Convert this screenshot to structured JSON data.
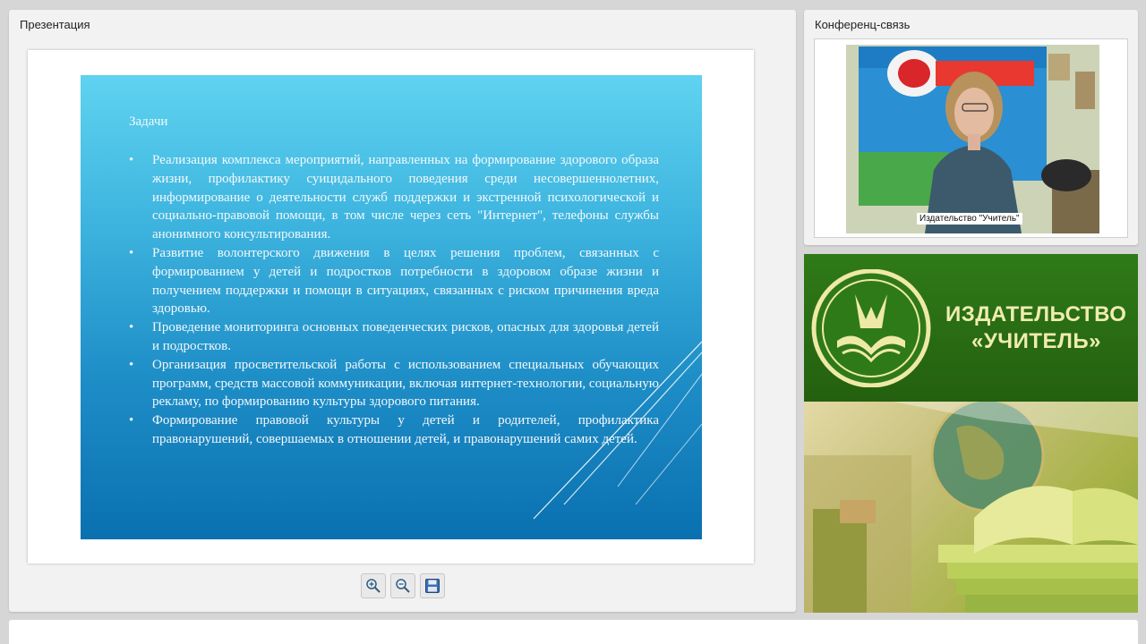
{
  "presentation": {
    "title": "Презентация",
    "slide": {
      "heading": "Задачи",
      "items": [
        "Реализация комплекса мероприятий, направленных на формирование здорового образа жизни, профилактику суицидального поведения среди несовершеннолетних, информирование о деятельности служб поддержки и экстренной психологической и социально-правовой помощи, в том числе через сеть \"Интернет\", телефоны службы анонимного консультирования.",
        "Развитие волонтерского движения в целях решения проблем, связанных с формированием у детей и подростков потребности в здоровом образе жизни и получением поддержки и помощи в ситуациях, связанных с риском причинения вреда здоровью.",
        "Проведение мониторинга основных поведенческих рисков, опасных для здоровья детей и подростков.",
        "Организация просветительской работы с использованием специальных обучающих программ, средств массовой коммуникации, включая интернет-технологии, социальную рекламу, по формированию культуры здорового питания.",
        "Формирование правовой культуры у детей и родителей, профилактика правонарушений, совершаемых в отношении детей, и правонарушений самих детей."
      ]
    },
    "toolbar": {
      "zoom_in_icon": "zoom-in-icon",
      "zoom_out_icon": "zoom-out-icon",
      "save_icon": "save-icon"
    }
  },
  "conference": {
    "title": "Конференц-связь",
    "participant_label": "Издательство \"Учитель\""
  },
  "banner": {
    "line1": "ИЗДАТЕЛЬСТВО",
    "line2": "«УЧИТЕЛЬ»"
  },
  "colors": {
    "slide_top": "#5fd3f0",
    "slide_bottom": "#0a70b0",
    "banner_green": "#2b6b16",
    "banner_text": "#f0ecb0"
  }
}
